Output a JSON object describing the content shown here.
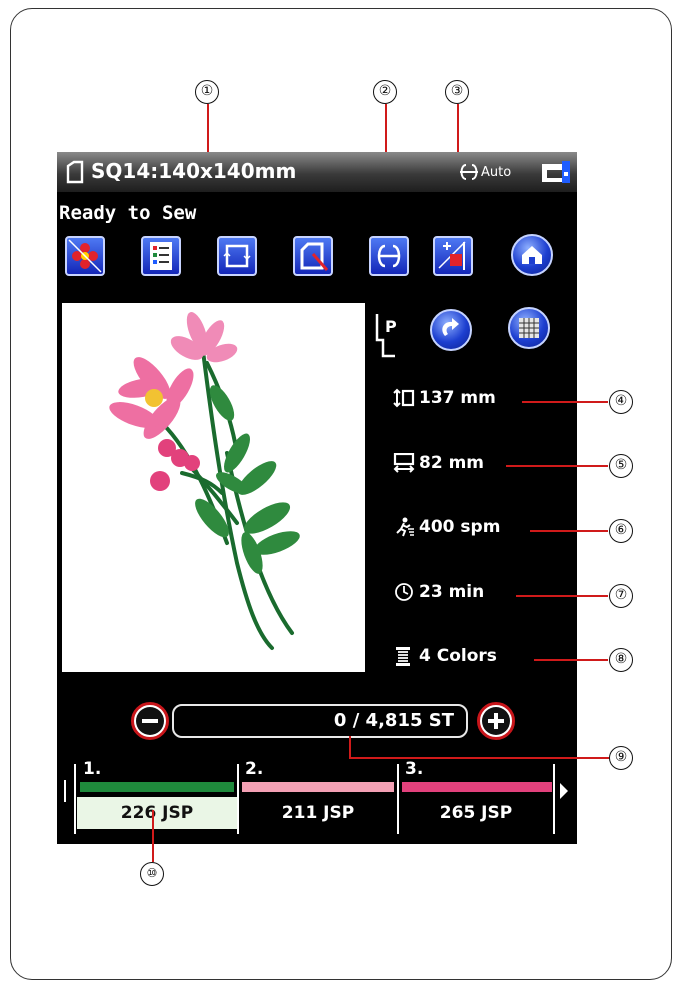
{
  "callouts": [
    "①",
    "②",
    "③",
    "④",
    "⑤",
    "⑥",
    "⑦",
    "⑧",
    "⑨",
    "⑩"
  ],
  "screen": {
    "hoop_title": "SQ14:140x140mm",
    "auto_label": "Auto",
    "status": "Ready to Sew",
    "toolbar_icons": [
      "design-select-icon",
      "color-list-icon",
      "trace-icon",
      "jog-icon",
      "thread-cut-icon",
      "crosshair-icon",
      "home-icon"
    ],
    "info": {
      "height": "137 mm",
      "width": "82 mm",
      "speed": "400 spm",
      "time": "23 min",
      "colors": "4 Colors"
    },
    "stitch_counter": "0 / 4,815 ST",
    "color_bar": [
      {
        "num": "1.",
        "label": "226 JSP",
        "color": "#1f8a3c"
      },
      {
        "num": "2.",
        "label": "211 JSP",
        "color": "#f3a0b4"
      },
      {
        "num": "3.",
        "label": "265 JSP",
        "color": "#e2417c"
      }
    ]
  },
  "colors": {
    "screen_bg": "#000000",
    "leader": "#d01a1a",
    "accent_blue": "#1d3fd0"
  }
}
